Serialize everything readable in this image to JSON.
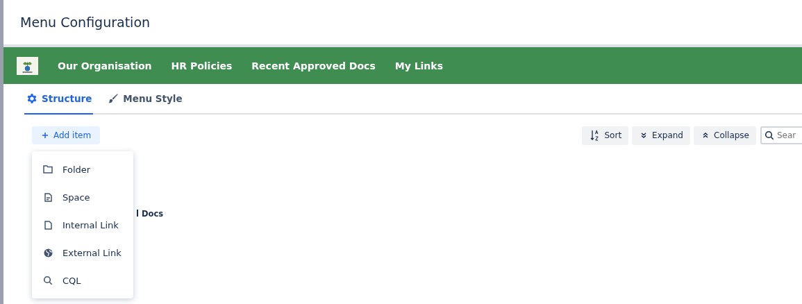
{
  "window": {
    "title": "Menu Configuration"
  },
  "nav": {
    "items": [
      "Our Organisation",
      "HR Policies",
      "Recent Approved Docs",
      "My Links"
    ]
  },
  "tabs": [
    {
      "label": "Structure",
      "kind": "gear",
      "selected": true
    },
    {
      "label": "Menu Style",
      "kind": "brush",
      "selected": false
    }
  ],
  "add_button": {
    "label": "Add item"
  },
  "toolbar": [
    {
      "label": "Sort",
      "kind": "sort"
    },
    {
      "label": "Expand",
      "kind": "expand"
    },
    {
      "label": "Collapse",
      "kind": "collapse"
    }
  ],
  "search": {
    "placeholder": "Sear"
  },
  "tree_items": [
    "l Docs"
  ],
  "add_menu": [
    {
      "label": "Folder",
      "kind": "folder"
    },
    {
      "label": "Space",
      "kind": "space"
    },
    {
      "label": "Internal Link",
      "kind": "page"
    },
    {
      "label": "External Link",
      "kind": "globe"
    },
    {
      "label": "CQL",
      "kind": "search"
    }
  ]
}
